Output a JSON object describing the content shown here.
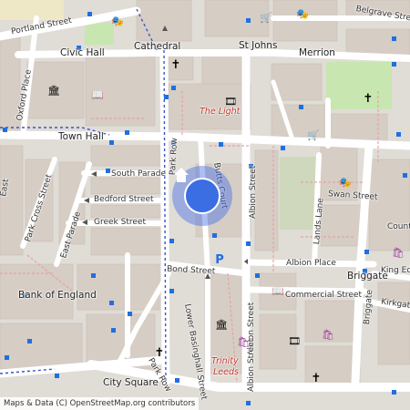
{
  "streets": {
    "portland_street": "Portland Street",
    "civic_hall": "Civic Hall",
    "cathedral": "Cathedral",
    "st_johns": "St Johns",
    "merrion": "Merrion",
    "belgrave_street": "Belgrave Street",
    "oxford_place": "Oxford Place",
    "town_hall": "Town Hall",
    "park_row": "Park Row",
    "south_parade": "South Parade",
    "bedford_street": "Bedford Street",
    "greek_street": "Greek Street",
    "park_cross_street": "Park Cross Street",
    "east_parade": "East Parade",
    "east": "East",
    "butts_court": "Butts Court",
    "albion_street": "Albion Street",
    "lands_lane": "Lands Lane",
    "swan_street": "Swan Street",
    "albion_place": "Albion Place",
    "briggate": "Briggate",
    "king_ed": "King Ed",
    "kirkgate": "Kirkgate",
    "count": "Count",
    "bond_street": "Bond Street",
    "commercial_street": "Commercial Street",
    "lower_basinghall_street": "Lower Basinghall Street",
    "bank_of_england": "Bank of England",
    "park_row_short": "Park Row",
    "city_square": "City Square"
  },
  "landmarks": {
    "the_light": "The Light",
    "trinity": "Trinity",
    "leeds": "Leeds"
  },
  "icons": {
    "theatre": "theatre-icon",
    "church": "church-icon",
    "cinema": "cinema-icon",
    "museum": "museum-icon",
    "library": "library-icon",
    "shop": "shopping-icon",
    "parking": "parking-icon",
    "location": "home-location-icon"
  },
  "colors": {
    "road": "#ffffff",
    "building": "#d8d0c9",
    "park": "#c8e6b0",
    "bus_stop": "#1f6fe0",
    "pin": "#3b6de3"
  },
  "attribution": {
    "prefix": "Maps & Data (C)",
    "link": "OpenStreetMap.org contributors"
  }
}
